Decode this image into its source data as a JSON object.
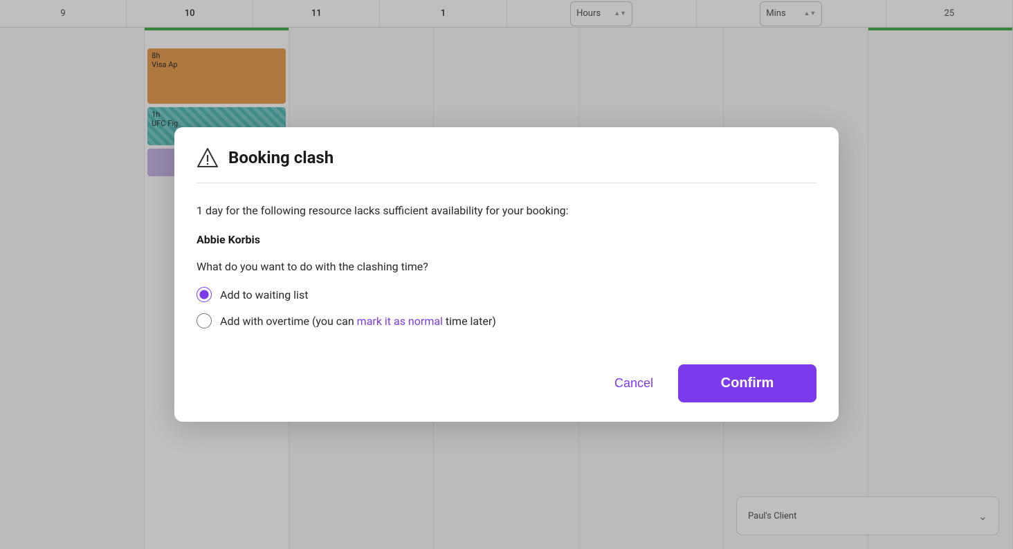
{
  "calendar": {
    "header_numbers": [
      "9",
      "10",
      "11",
      "1",
      "Hours",
      "Mins",
      "25"
    ],
    "event1_line1": "8h",
    "event1_line2": "Visa Ap",
    "event2_line1": "1h",
    "event2_line2": "UFC Fig",
    "bottom_client": "Paul's Client",
    "chevron": "˅"
  },
  "dialog": {
    "title": "Booking clash",
    "warning_icon_label": "warning",
    "message": "1 day for the following resource lacks sufficient availability for your booking:",
    "resource_name": "Abbie Korbis",
    "question": "What do you want to do with the clashing time?",
    "options": [
      {
        "id": "waiting",
        "label": "Add to waiting list",
        "checked": true
      },
      {
        "id": "overtime",
        "label_before": "Add with overtime (you can ",
        "link_text": "mark it as normal",
        "label_after": " time later)",
        "checked": false
      }
    ],
    "cancel_label": "Cancel",
    "confirm_label": "Confirm"
  }
}
